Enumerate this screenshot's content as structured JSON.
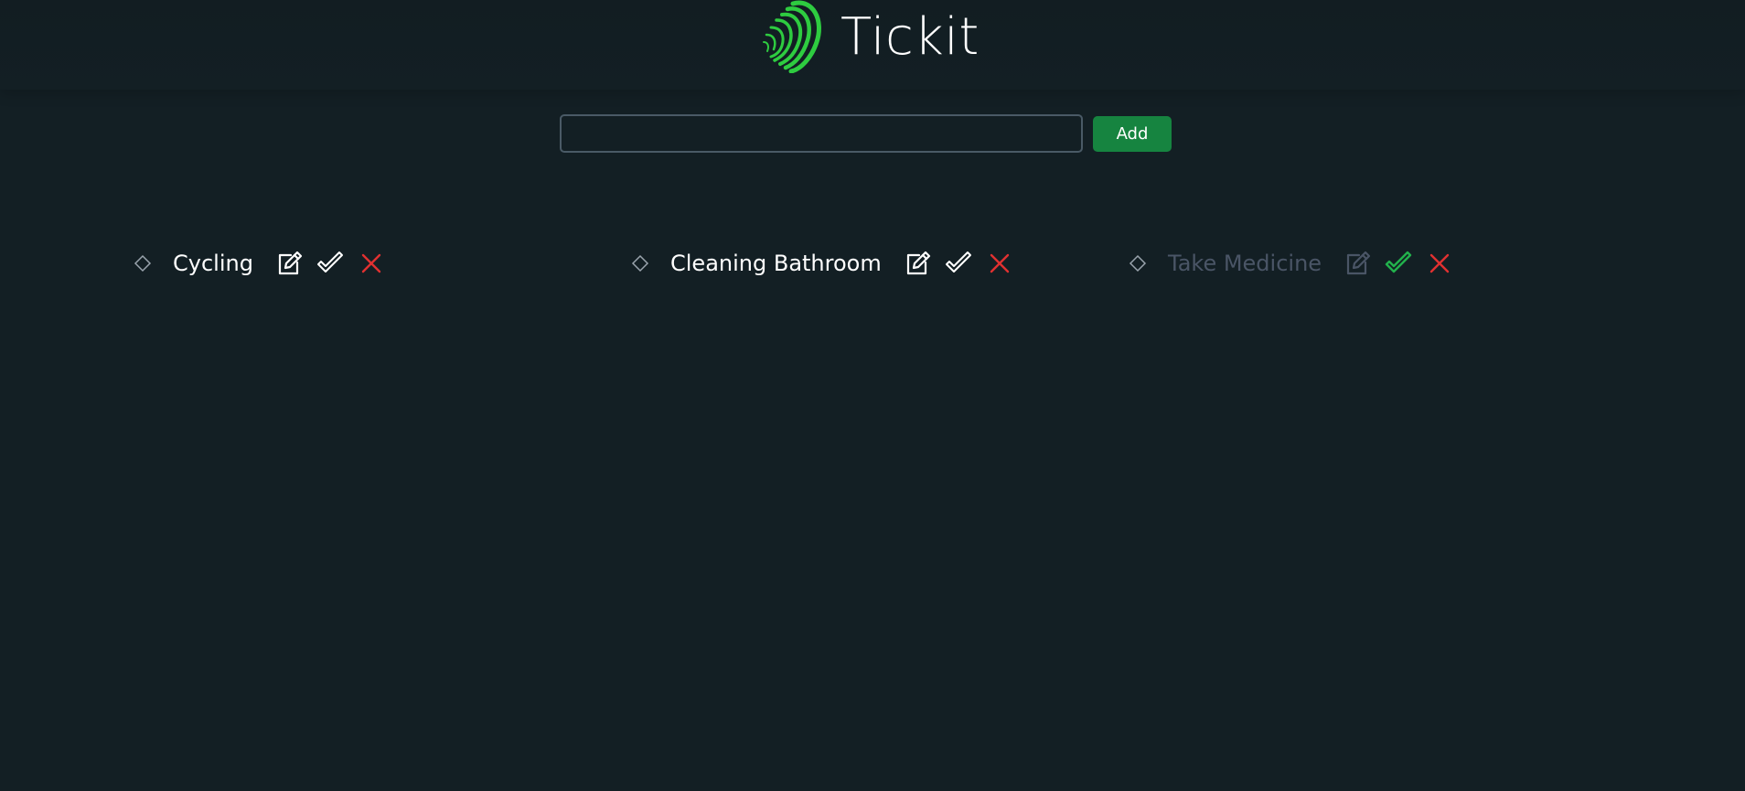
{
  "app": {
    "title": "Tickit"
  },
  "colors": {
    "background": "#131f24",
    "accent_green": "#168440",
    "logo_green": "#2ecc40",
    "delete_red": "#e03131",
    "done_check_green": "#22b14c",
    "done_text": "#4a5566"
  },
  "form": {
    "input_value": "",
    "input_placeholder": "",
    "add_label": "Add"
  },
  "tasks": [
    {
      "label": "Cycling",
      "completed": false,
      "icons": [
        "diamond-icon",
        "edit-icon",
        "check-icon",
        "close-icon"
      ]
    },
    {
      "label": "Cleaning Bathroom",
      "completed": false,
      "icons": [
        "diamond-icon",
        "edit-icon",
        "check-icon",
        "close-icon"
      ]
    },
    {
      "label": "Take Medicine",
      "completed": true,
      "icons": [
        "diamond-icon",
        "edit-icon",
        "check-icon",
        "close-icon"
      ]
    }
  ]
}
